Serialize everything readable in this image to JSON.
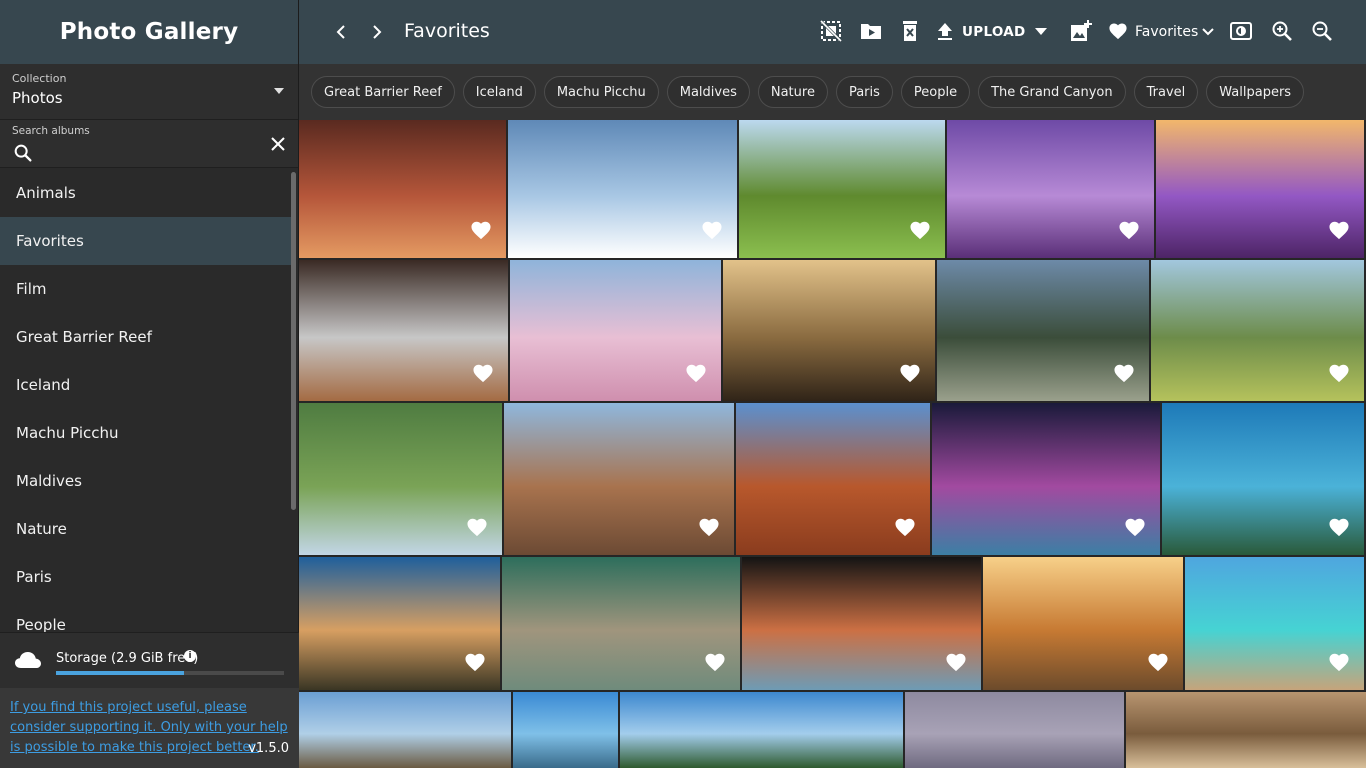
{
  "app": {
    "title": "Photo Gallery"
  },
  "sidebar": {
    "collection": {
      "label": "Collection",
      "value": "Photos"
    },
    "search": {
      "label": "Search albums",
      "value": ""
    },
    "albums": [
      {
        "label": "Animals"
      },
      {
        "label": "Favorites",
        "active": true
      },
      {
        "label": "Film"
      },
      {
        "label": "Great Barrier Reef"
      },
      {
        "label": "Iceland"
      },
      {
        "label": "Machu Picchu"
      },
      {
        "label": "Maldives"
      },
      {
        "label": "Nature"
      },
      {
        "label": "Paris"
      },
      {
        "label": "People"
      }
    ],
    "storage": {
      "text": "Storage (2.9 GiB free)",
      "used_fraction": 0.56
    },
    "support_text": "If you find this project useful, please consider supporting it. Only with your help is possible to make this project better.",
    "version": "v1.5.0"
  },
  "toolbar": {
    "title": "Favorites",
    "upload_label": "UPLOAD",
    "favorites_label": "Favorites",
    "icons": [
      "chevron-left-icon",
      "chevron-right-icon",
      "deselect-icon",
      "move-to-folder-icon",
      "delete-icon",
      "upload-icon",
      "caret-down-icon",
      "add-photo-icon",
      "heart-icon",
      "chevron-down-icon",
      "slideshow-icon",
      "zoom-in-icon",
      "zoom-out-icon"
    ]
  },
  "chips": [
    "Great Barrier Reef",
    "Iceland",
    "Machu Picchu",
    "Maldives",
    "Nature",
    "Paris",
    "People",
    "The Grand Canyon",
    "Travel",
    "Wallpapers"
  ],
  "colors": {
    "accent": "#37474f",
    "link": "#3d9de3",
    "storage_fill": "#4aa3df"
  },
  "photos": [
    {
      "scene": "antelope canyon",
      "colors": [
        "#5a2a20",
        "#b5563a",
        "#e49a62"
      ],
      "favorite": true
    },
    {
      "scene": "mountains above clouds",
      "colors": [
        "#5f89b7",
        "#a8c7e4",
        "#ffffff"
      ],
      "favorite": true
    },
    {
      "scene": "lone tree",
      "colors": [
        "#bcd9ef",
        "#5f8a2e",
        "#8bbf4f"
      ],
      "favorite": true
    },
    {
      "scene": "lavender field lake",
      "colors": [
        "#6e4aa6",
        "#b78ad6",
        "#5a2f78"
      ],
      "favorite": true
    },
    {
      "scene": "lavender sunset",
      "colors": [
        "#f2b76b",
        "#9358c4",
        "#4d2466"
      ],
      "favorite": true
    },
    {
      "scene": "airplane window petra",
      "colors": [
        "#3a2a24",
        "#c7c7c7",
        "#a46b43"
      ],
      "favorite": true
    },
    {
      "scene": "airplane wing sky",
      "colors": [
        "#8fb4da",
        "#e8bfd4",
        "#cf8fae"
      ],
      "favorite": true
    },
    {
      "scene": "friends at sunset",
      "colors": [
        "#e2c28a",
        "#8a6b40",
        "#302418"
      ],
      "favorite": true
    },
    {
      "scene": "machu picchu",
      "colors": [
        "#6d8aa8",
        "#3b4d3a",
        "#9aa08c"
      ],
      "favorite": true
    },
    {
      "scene": "llama machu picchu",
      "colors": [
        "#a2c7de",
        "#6d8c4a",
        "#b5c25c"
      ],
      "favorite": true
    },
    {
      "scene": "machu picchu green",
      "colors": [
        "#4f7c41",
        "#7aa356",
        "#c2d6e6"
      ],
      "favorite": true
    },
    {
      "scene": "grand canyon",
      "colors": [
        "#8fb7dd",
        "#a8734e",
        "#6c4a34"
      ],
      "favorite": true
    },
    {
      "scene": "monument valley",
      "colors": [
        "#5b90cf",
        "#b8582c",
        "#8a3c1e"
      ],
      "favorite": true
    },
    {
      "scene": "coral reef",
      "colors": [
        "#1a1a3a",
        "#a24aa0",
        "#3c7fa4"
      ],
      "favorite": true
    },
    {
      "scene": "underwater fish",
      "colors": [
        "#1e7ab8",
        "#4bb2d8",
        "#2a5a3a"
      ],
      "favorite": true
    },
    {
      "scene": "uluru",
      "colors": [
        "#1f5f9c",
        "#d79f62",
        "#3a3624"
      ],
      "favorite": true
    },
    {
      "scene": "reef aerial",
      "colors": [
        "#2d6e5c",
        "#a0957d",
        "#6f8b7c"
      ],
      "favorite": true
    },
    {
      "scene": "anemone",
      "colors": [
        "#141414",
        "#cc7044",
        "#6e9bb5"
      ],
      "favorite": true
    },
    {
      "scene": "twelve apostles",
      "colors": [
        "#f7d089",
        "#c77a33",
        "#6c4b2c"
      ],
      "favorite": true
    },
    {
      "scene": "maldives pier",
      "colors": [
        "#4fa6df",
        "#46d3d3",
        "#c6a47b"
      ],
      "favorite": true
    },
    {
      "scene": "huts over water",
      "colors": [
        "#6b9fd4",
        "#b0cfe7",
        "#6a5a42"
      ],
      "favorite": false
    },
    {
      "scene": "beach pier",
      "colors": [
        "#3a8ad4",
        "#7fc0e8",
        "#3a6b8a"
      ],
      "favorite": false
    },
    {
      "scene": "palm beach",
      "colors": [
        "#3d88cf",
        "#a3cdec",
        "#2e5a2e"
      ],
      "favorite": false
    },
    {
      "scene": "eiffel tower",
      "colors": [
        "#8e8aa0",
        "#a8a2b6",
        "#6f6a80"
      ],
      "favorite": false
    },
    {
      "scene": "arc ceiling",
      "colors": [
        "#b89570",
        "#7a5c3d",
        "#d8bf9a"
      ],
      "favorite": false
    }
  ]
}
